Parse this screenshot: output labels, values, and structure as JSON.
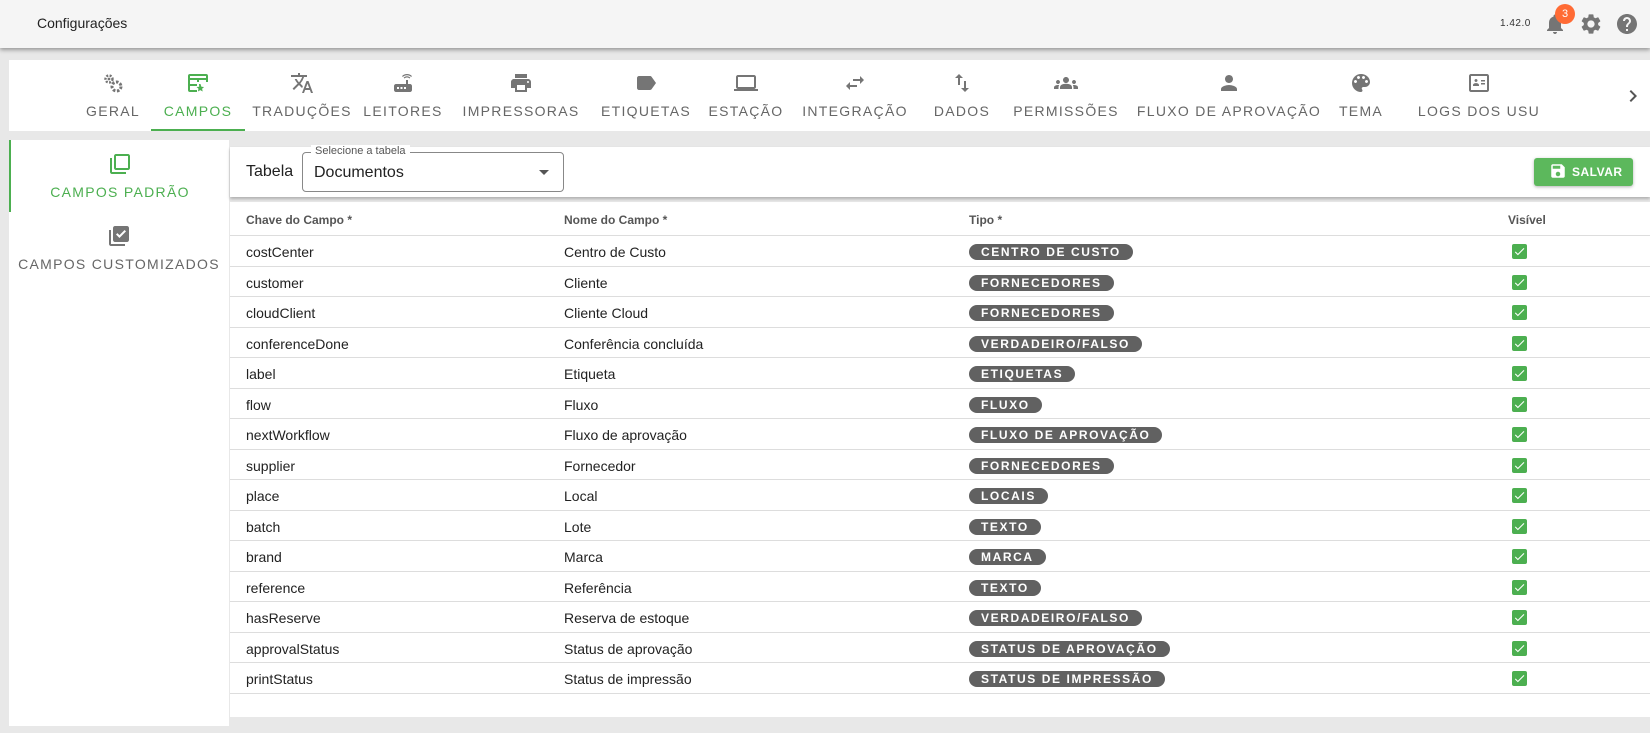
{
  "app": {
    "title": "Configurações",
    "version": "1.42.0",
    "notification_count": "3"
  },
  "tabs": [
    {
      "label": "GERAL",
      "icon": "gears-icon",
      "active": false
    },
    {
      "label": "CAMPOS",
      "icon": "table-edit-icon",
      "active": true
    },
    {
      "label": "TRADUÇÕES",
      "icon": "translate-icon",
      "active": false
    },
    {
      "label": "LEITORES",
      "icon": "router-icon",
      "active": false
    },
    {
      "label": "IMPRESSORAS",
      "icon": "printer-icon",
      "active": false
    },
    {
      "label": "ETIQUETAS",
      "icon": "label-icon",
      "active": false
    },
    {
      "label": "ESTAÇÃO",
      "icon": "laptop-icon",
      "active": false
    },
    {
      "label": "INTEGRAÇÃO",
      "icon": "swap-icon",
      "active": false
    },
    {
      "label": "DADOS",
      "icon": "import-export-icon",
      "active": false
    },
    {
      "label": "PERMISSÕES",
      "icon": "group-icon",
      "active": false
    },
    {
      "label": "FLUXO DE APROVAÇÃO",
      "icon": "person-icon",
      "active": false
    },
    {
      "label": "TEMA",
      "icon": "palette-icon",
      "active": false
    },
    {
      "label": "LOGS DOS USU",
      "icon": "id-card-icon",
      "active": false
    }
  ],
  "sidenav": {
    "items": [
      {
        "label": "CAMPOS PADRÃO",
        "icon": "library-icon",
        "active": true
      },
      {
        "label": "CAMPOS CUSTOMIZADOS",
        "icon": "library-check-icon",
        "active": false
      }
    ]
  },
  "toolbar": {
    "table_label": "Tabela",
    "select_legend": "Selecione a tabela",
    "select_value": "Documentos",
    "save_label": "SALVAR"
  },
  "table": {
    "headers": [
      "Chave do Campo *",
      "Nome do Campo *",
      "Tipo *",
      "Visível"
    ],
    "rows": [
      {
        "key": "costCenter",
        "name": "Centro de Custo",
        "type": "CENTRO DE CUSTO",
        "visible": true
      },
      {
        "key": "customer",
        "name": "Cliente",
        "type": "FORNECEDORES",
        "visible": true
      },
      {
        "key": "cloudClient",
        "name": "Cliente Cloud",
        "type": "FORNECEDORES",
        "visible": true
      },
      {
        "key": "conferenceDone",
        "name": "Conferência concluída",
        "type": "VERDADEIRO/FALSO",
        "visible": true
      },
      {
        "key": "label",
        "name": "Etiqueta",
        "type": "ETIQUETAS",
        "visible": true
      },
      {
        "key": "flow",
        "name": "Fluxo",
        "type": "FLUXO",
        "visible": true
      },
      {
        "key": "nextWorkflow",
        "name": "Fluxo de aprovação",
        "type": "FLUXO DE APROVAÇÃO",
        "visible": true
      },
      {
        "key": "supplier",
        "name": "Fornecedor",
        "type": "FORNECEDORES",
        "visible": true
      },
      {
        "key": "place",
        "name": "Local",
        "type": "LOCAIS",
        "visible": true
      },
      {
        "key": "batch",
        "name": "Lote",
        "type": "TEXTO",
        "visible": true
      },
      {
        "key": "brand",
        "name": "Marca",
        "type": "MARCA",
        "visible": true
      },
      {
        "key": "reference",
        "name": "Referência",
        "type": "TEXTO",
        "visible": true
      },
      {
        "key": "hasReserve",
        "name": "Reserva de estoque",
        "type": "VERDADEIRO/FALSO",
        "visible": true
      },
      {
        "key": "approvalStatus",
        "name": "Status de aprovação",
        "type": "STATUS DE APROVAÇÃO",
        "visible": true
      },
      {
        "key": "printStatus",
        "name": "Status de impressão",
        "type": "STATUS DE IMPRESSÃO",
        "visible": true
      }
    ]
  },
  "colors": {
    "accent": "#4caf50",
    "chip": "#616161",
    "badge": "#ff6b35",
    "save": "#5cb85c"
  }
}
